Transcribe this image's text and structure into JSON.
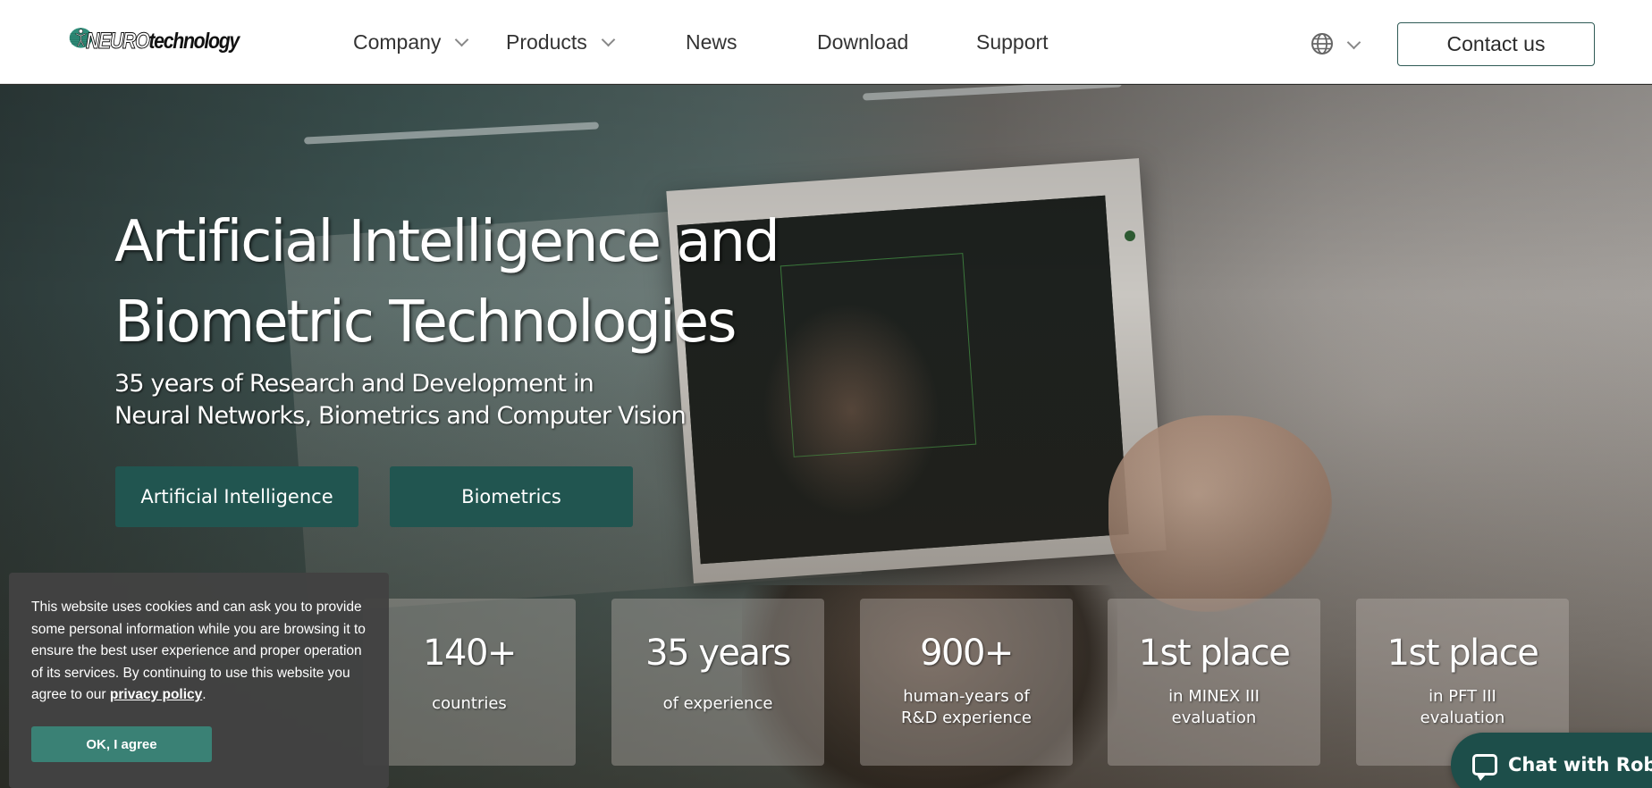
{
  "header": {
    "logo": {
      "brand_prefix": "NEURO",
      "brand_suffix": "technology"
    },
    "nav": [
      {
        "label": "Company",
        "has_dropdown": true
      },
      {
        "label": "Products",
        "has_dropdown": true
      },
      {
        "label": "News",
        "has_dropdown": false
      },
      {
        "label": "Download",
        "has_dropdown": false
      },
      {
        "label": "Support",
        "has_dropdown": false
      }
    ],
    "language_icon": "globe-icon",
    "contact_label": "Contact us"
  },
  "hero": {
    "title": "Artificial Intelligence and\nBiometric Technologies",
    "subtitle": "35 years of Research and Development in\nNeural Networks, Biometrics and Computer Vision",
    "buttons": [
      {
        "label": "Artificial Intelligence"
      },
      {
        "label": "Biometrics"
      }
    ],
    "stats": [
      {
        "value": "140+",
        "label": "countries"
      },
      {
        "value": "35 years",
        "label": "of experience"
      },
      {
        "value": "900+",
        "label": "human-years of\nR&D experience"
      },
      {
        "value": "1st place",
        "label": "in MINEX III\nevaluation"
      },
      {
        "value": "1st place",
        "label": "in PFT III\nevaluation"
      }
    ]
  },
  "cookie": {
    "text": "This website uses cookies and can ask you to provide some personal information while you are browsing it to ensure the best user experience and proper operation of its services. By continuing to use this website you agree to our ",
    "link": "privacy policy",
    "end": ".",
    "button": "OK, I agree"
  },
  "chat": {
    "label": "Chat with Rober"
  },
  "colors": {
    "brand_teal": "#215550",
    "cookie_button": "#3a8175",
    "chat_bg": "#1d4e4a"
  }
}
